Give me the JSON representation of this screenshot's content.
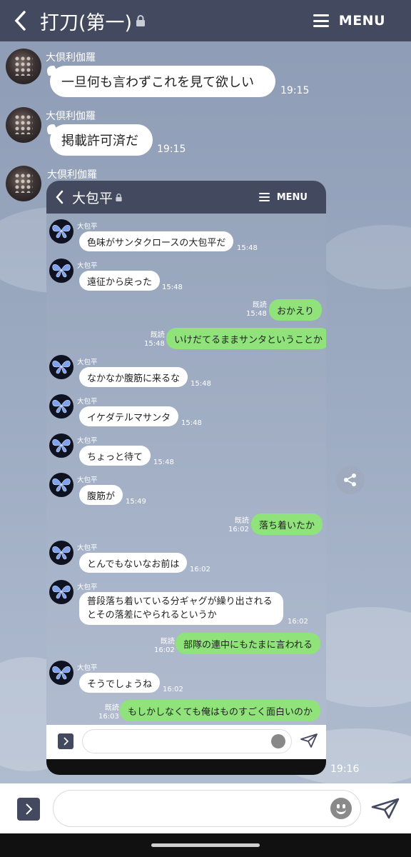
{
  "header": {
    "title": "打刀(第一)",
    "menu_label": "MENU"
  },
  "messages": [
    {
      "sender": "大倶利伽羅",
      "text": "一旦何も言わずこれを見て欲しい",
      "time": "19:15"
    },
    {
      "sender": "大倶利伽羅",
      "text": "掲載許可済だ",
      "time": "19:15"
    },
    {
      "sender": "大倶利伽羅",
      "time": "19:16"
    }
  ],
  "shot": {
    "title": "大包平",
    "menu_label": "MENU",
    "read_label": "既読",
    "messages": [
      {
        "side": "left",
        "sender": "大包平",
        "text": "色味がサンタクロースの大包平だ",
        "time": "15:48"
      },
      {
        "side": "left",
        "sender": "大包平",
        "text": "遠征から戻った",
        "time": "15:48"
      },
      {
        "side": "right",
        "text": "おかえり",
        "time": "15:48"
      },
      {
        "side": "right",
        "text": "いけだてるままサンタということか",
        "time": "15:48"
      },
      {
        "side": "left",
        "sender": "大包平",
        "text": "なかなか腹筋に来るな",
        "time": "15:48"
      },
      {
        "side": "left",
        "sender": "大包平",
        "text": "イケダテルマサンタ",
        "time": "15:48"
      },
      {
        "side": "left",
        "sender": "大包平",
        "text": "ちょっと待て",
        "time": "15:48"
      },
      {
        "side": "left",
        "sender": "大包平",
        "text": "腹筋が",
        "time": "15:49"
      },
      {
        "side": "right",
        "text": "落ち着いたか",
        "time": "16:02"
      },
      {
        "side": "left",
        "sender": "大包平",
        "text": "とんでもないなお前は",
        "time": "16:02"
      },
      {
        "side": "left",
        "sender": "大包平",
        "lines": [
          "普段落ち着いている分ギャグが繰り出される",
          "とその落差にやられるというか"
        ],
        "time": "16:02"
      },
      {
        "side": "right",
        "text": "部隊の連中にもたまに言われる",
        "time": "16:02"
      },
      {
        "side": "left",
        "sender": "大包平",
        "text": "そうでしょうね",
        "time": "16:02"
      },
      {
        "side": "right",
        "text": "もしかしなくても俺はものすごく面白いのか",
        "time": "16:03"
      }
    ]
  },
  "icons": {
    "back": "chevron-left-icon",
    "lock": "lock-icon",
    "menu": "hamburger-icon",
    "share": "share-icon",
    "plus": "chevron-right-icon",
    "emoji": "smiley-icon",
    "send": "send-icon"
  },
  "colors": {
    "header": "#434a5f",
    "green_bubble": "#8fe37a",
    "bubble": "#ffffff"
  }
}
